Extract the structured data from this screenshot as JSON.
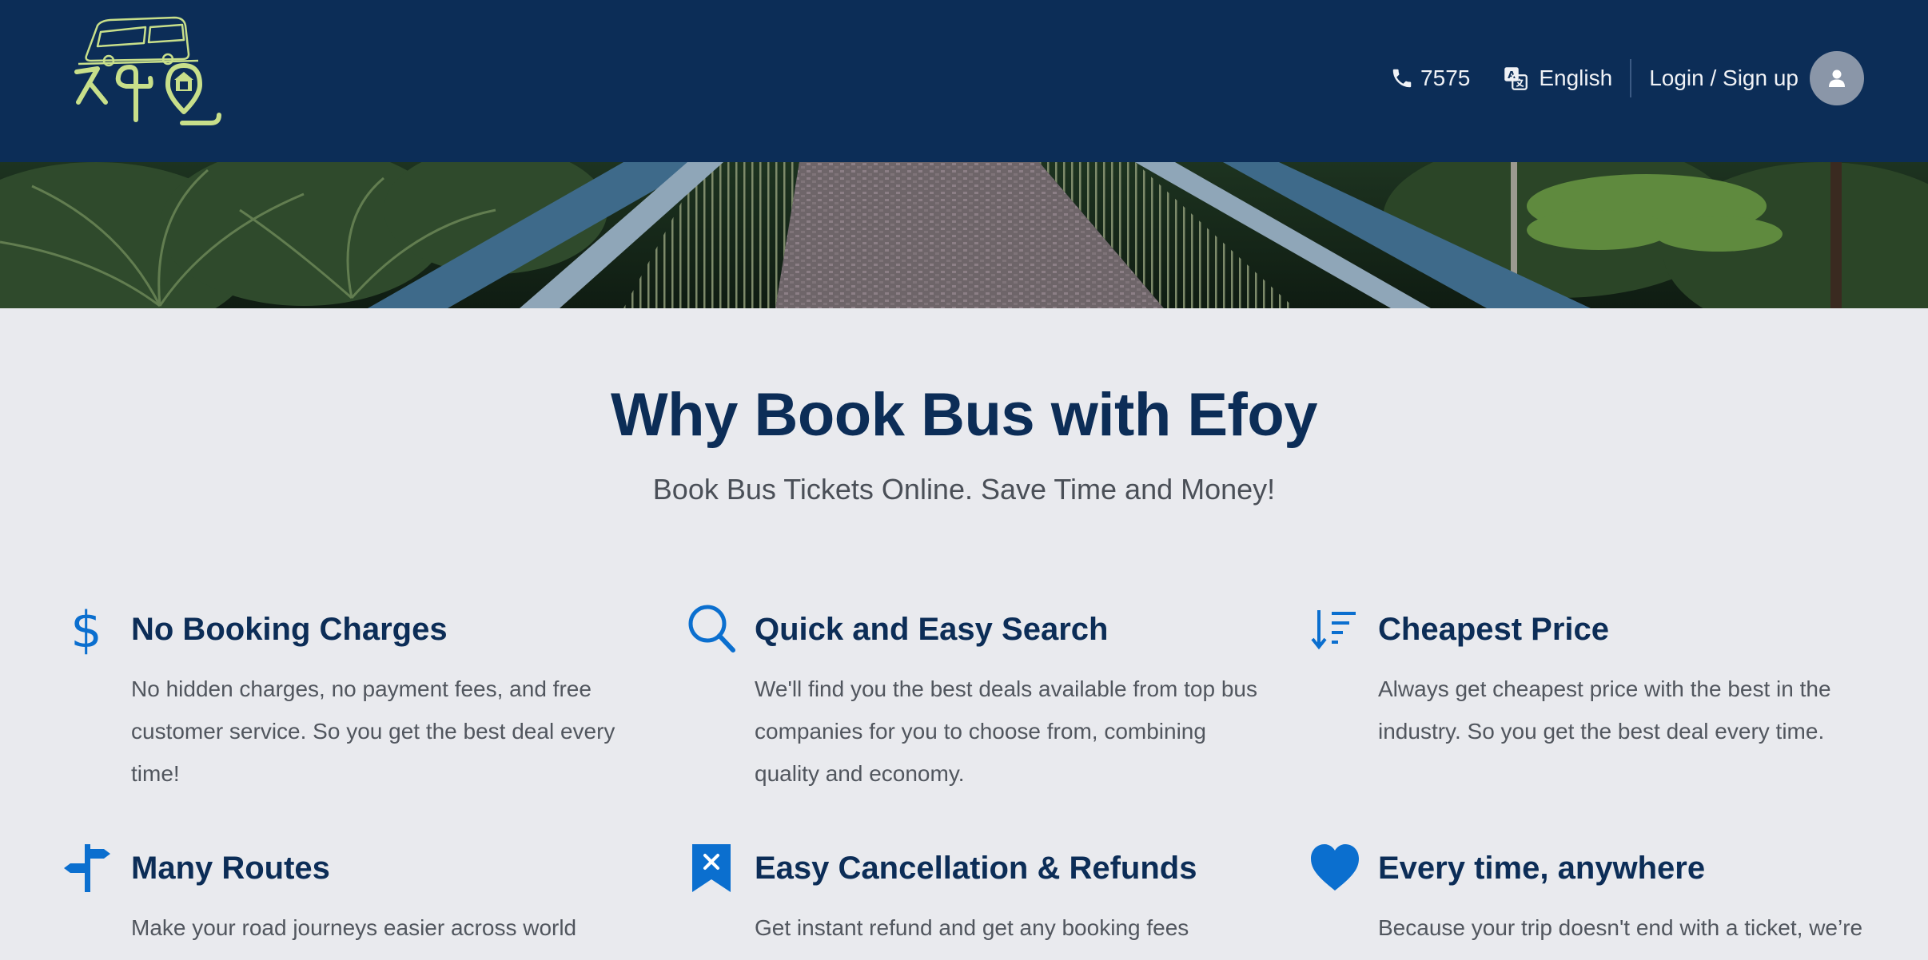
{
  "header": {
    "phone": "7575",
    "language": "English",
    "login_label": "Login / Sign up"
  },
  "colors": {
    "header_bg": "#0c2d57",
    "page_bg": "#e9eaee",
    "accent_icon": "#0b6fcf",
    "logo_green": "#c8df8a"
  },
  "section": {
    "title": "Why Book Bus with Efoy",
    "subtitle": "Book Bus Tickets Online. Save Time and Money!"
  },
  "features": [
    {
      "icon": "dollar-icon",
      "title": "No Booking Charges",
      "text": "No hidden charges, no payment fees, and free customer service. So you get the best deal every time!"
    },
    {
      "icon": "search-icon",
      "title": "Quick and Easy Search",
      "text": "We'll find you the best deals available from top bus companies for you to choose from, combining quality and economy."
    },
    {
      "icon": "sort-icon",
      "title": "Cheapest Price",
      "text": "Always get cheapest price with the best in the industry. So you get the best deal every time."
    },
    {
      "icon": "signpost-icon",
      "title": "Many Routes",
      "text": "Make your road journeys easier across world"
    },
    {
      "icon": "bookmark-x-icon",
      "title": "Easy Cancellation & Refunds",
      "text": "Get instant refund and get any booking fees"
    },
    {
      "icon": "heart-icon",
      "title": "Every time, anywhere",
      "text": "Because your trip doesn't end with a ticket, we’re"
    }
  ]
}
